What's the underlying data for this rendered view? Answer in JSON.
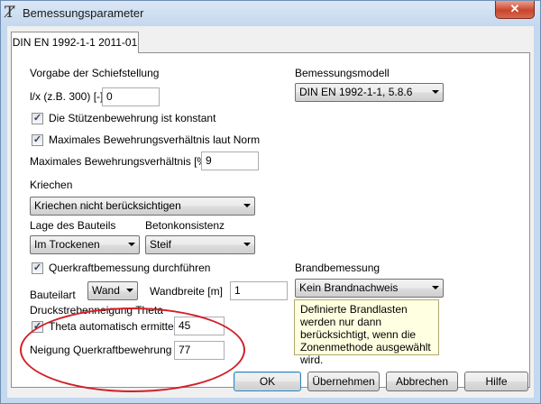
{
  "window": {
    "title": "Bemessungsparameter",
    "close_symbol": "✕",
    "app_icon": "beam-symbol-icon"
  },
  "tab": {
    "label": "DIN EN 1992-1-1 2011-01"
  },
  "schiefstellung": {
    "heading": "Vorgabe der Schiefstellung",
    "lx_label": "l/x (z.B. 300) [-]",
    "lx_value": "0"
  },
  "stuetzen": {
    "konstant_label": "Die Stützenbewehrung ist konstant",
    "konstant_checked": true,
    "max_norm_label": "Maximales Bewehrungsverhältnis laut Norm",
    "max_norm_checked": true,
    "max_ratio_label": "Maximales Bewehrungsverhältnis [%]",
    "max_ratio_value": "9"
  },
  "bemessungsmodell": {
    "label": "Bemessungsmodell",
    "value": "DIN EN 1992-1-1, 5.8.6"
  },
  "kriechen": {
    "label": "Kriechen",
    "value": "Kriechen nicht berücksichtigen"
  },
  "lage": {
    "label": "Lage des Bauteils",
    "value": "Im Trockenen"
  },
  "beton": {
    "label": "Betonkonsistenz",
    "value": "Steif"
  },
  "querkraft": {
    "label": "Querkraftbemessung durchführen",
    "checked": true,
    "bauteilart_label": "Bauteilart",
    "bauteilart_value": "Wand",
    "wandbreite_label": "Wandbreite [m]",
    "wandbreite_value": "1"
  },
  "brand": {
    "label": "Brandbemessung",
    "value": "Kein Brandnachweis",
    "tooltip": "Definierte Brandlasten werden nur dann berücksichtigt, wenn die Zonenmethode ausgewählt wird."
  },
  "druckstrebe": {
    "heading": "Druckstrebenneigung Theta",
    "theta_auto_label": "Theta automatisch ermitteln",
    "theta_auto_checked": true,
    "theta_value": "45",
    "neigung_label": "Neigung Querkraftbewehrung [°]",
    "neigung_value": "77"
  },
  "buttons": {
    "ok": "OK",
    "uebernehmen": "Übernehmen",
    "abbrechen": "Abbrechen",
    "hilfe": "Hilfe"
  },
  "check_mark": "✓",
  "colors": {
    "highlight_ellipse": "#d12028"
  }
}
